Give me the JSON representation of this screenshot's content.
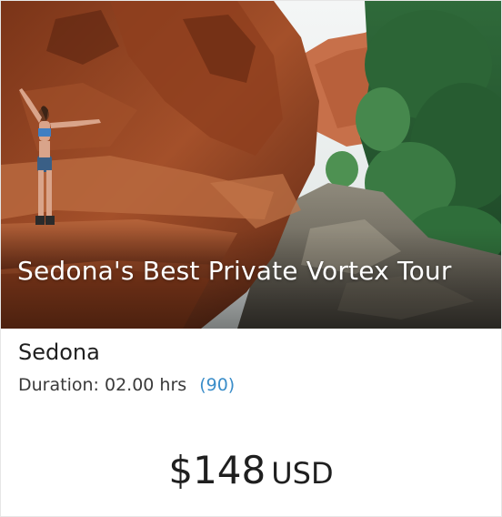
{
  "tour": {
    "title": "Sedona's Best Private Vortex Tour",
    "location": "Sedona",
    "duration_label": "Duration:",
    "duration_value": "02.00 hrs",
    "review_count": "(90)",
    "price": "$148",
    "currency": "USD"
  },
  "colors": {
    "review_link": "#3a8dc9",
    "text": "#1f1f1f"
  }
}
